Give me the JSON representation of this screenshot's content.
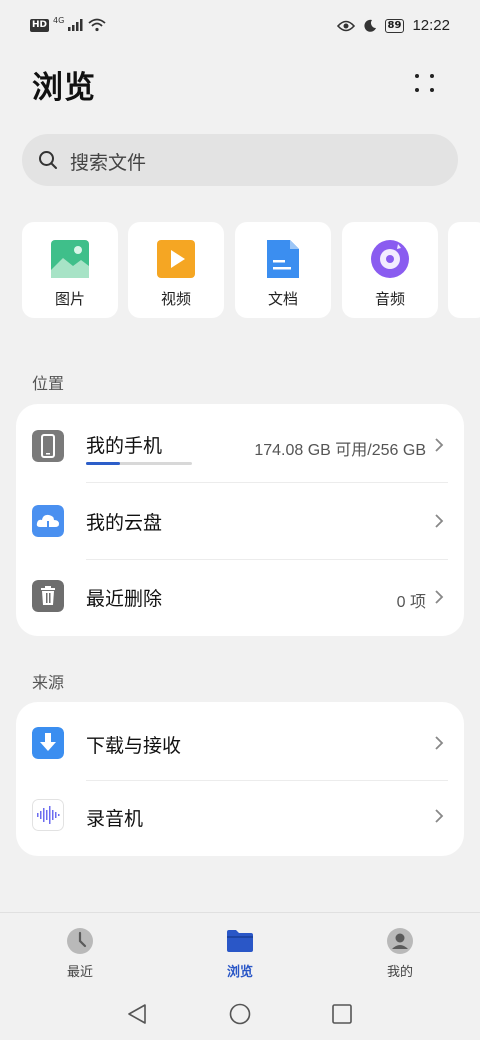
{
  "status_bar": {
    "hd": "HD",
    "network": "4G",
    "battery": "89",
    "time": "12:22"
  },
  "header": {
    "title": "浏览"
  },
  "search": {
    "placeholder": "搜索文件"
  },
  "categories": [
    {
      "label": "图片",
      "icon": "image-icon"
    },
    {
      "label": "视频",
      "icon": "video-icon"
    },
    {
      "label": "文档",
      "icon": "document-icon"
    },
    {
      "label": "音频",
      "icon": "audio-icon"
    }
  ],
  "locations": {
    "section_label": "位置",
    "items": [
      {
        "title": "我的手机",
        "meta": "174.08 GB 可用/256 GB",
        "icon": "phone-icon",
        "storage_used_fraction": 0.32
      },
      {
        "title": "我的云盘",
        "meta": "",
        "icon": "cloud-drive-icon"
      },
      {
        "title": "最近删除",
        "meta": "0 项",
        "icon": "trash-icon"
      }
    ]
  },
  "sources": {
    "section_label": "来源",
    "items": [
      {
        "title": "下载与接收",
        "icon": "download-icon"
      },
      {
        "title": "录音机",
        "icon": "recorder-icon"
      }
    ]
  },
  "bottom_nav": {
    "items": [
      {
        "label": "最近",
        "icon": "clock-icon",
        "active": false
      },
      {
        "label": "浏览",
        "icon": "folder-icon",
        "active": true
      },
      {
        "label": "我的",
        "icon": "profile-icon",
        "active": false
      }
    ]
  },
  "colors": {
    "accent": "#2a57c7",
    "background": "#f1f1f1",
    "card": "#ffffff",
    "image_icon": "#3fbf8a",
    "video_icon": "#f5a623",
    "document_icon": "#3b8ef0",
    "audio_icon": "#8a5cf0"
  }
}
